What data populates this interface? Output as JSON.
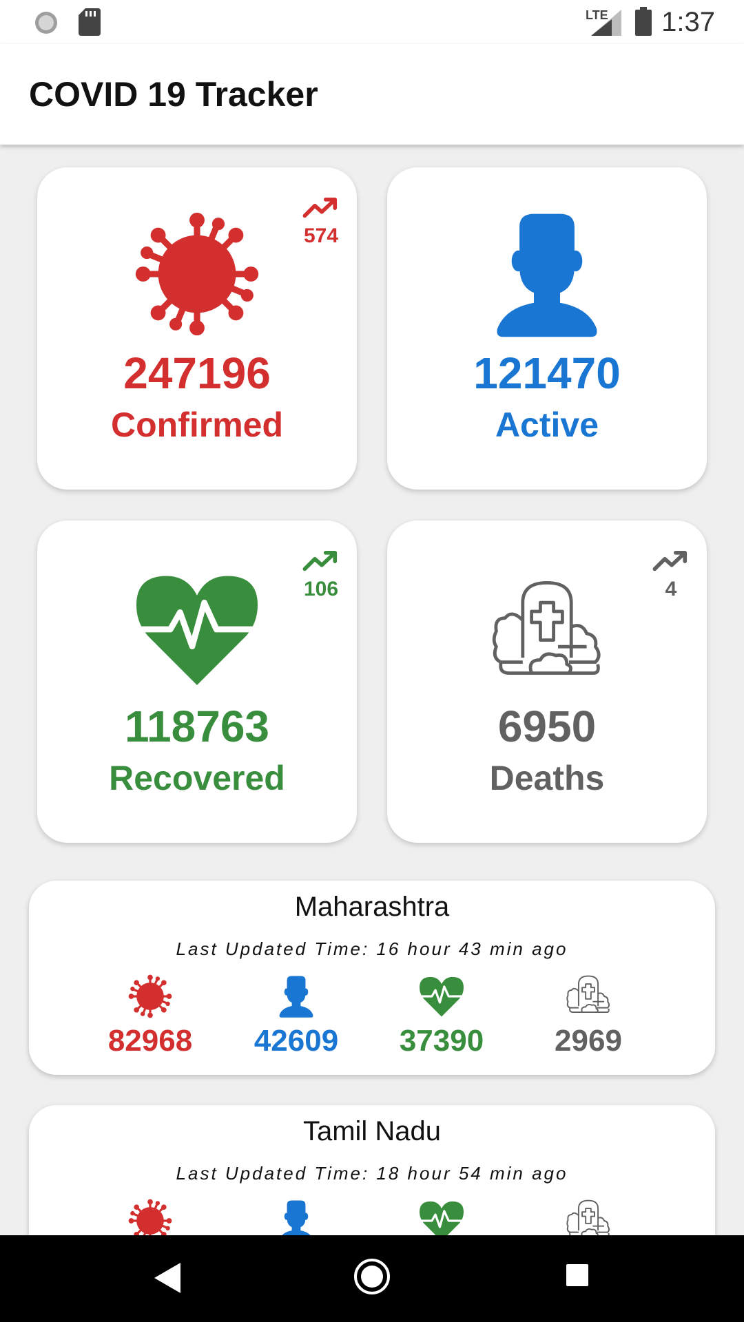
{
  "status_bar": {
    "time": "1:37",
    "network": "LTE",
    "icons": [
      "loading-circle-icon",
      "sd-card-icon",
      "signal-icon",
      "battery-icon"
    ]
  },
  "app_bar": {
    "title": "COVID 19 Tracker"
  },
  "colors": {
    "confirmed": "#d32f2f",
    "active": "#1976d2",
    "recovered": "#388e3c",
    "deaths": "#616161"
  },
  "summary": {
    "confirmed": {
      "value": "247196",
      "label": "Confirmed",
      "delta": "574",
      "icon": "virus-icon"
    },
    "active": {
      "value": "121470",
      "label": "Active",
      "icon": "person-icon"
    },
    "recovered": {
      "value": "118763",
      "label": "Recovered",
      "delta": "106",
      "icon": "heart-pulse-icon"
    },
    "deaths": {
      "value": "6950",
      "label": "Deaths",
      "delta": "4",
      "icon": "grave-icon"
    }
  },
  "states": [
    {
      "name": "Maharashtra",
      "updated": "Last Updated Time: 16 hour 43 min ago",
      "confirmed": "82968",
      "active": "42609",
      "recovered": "37390",
      "deaths": "2969"
    },
    {
      "name": "Tamil Nadu",
      "updated": "Last Updated Time: 18 hour 54 min ago",
      "confirmed": "",
      "active": "",
      "recovered": "",
      "deaths": ""
    }
  ],
  "nav_bar": {
    "buttons": [
      "back-icon",
      "home-icon",
      "recents-icon"
    ]
  }
}
